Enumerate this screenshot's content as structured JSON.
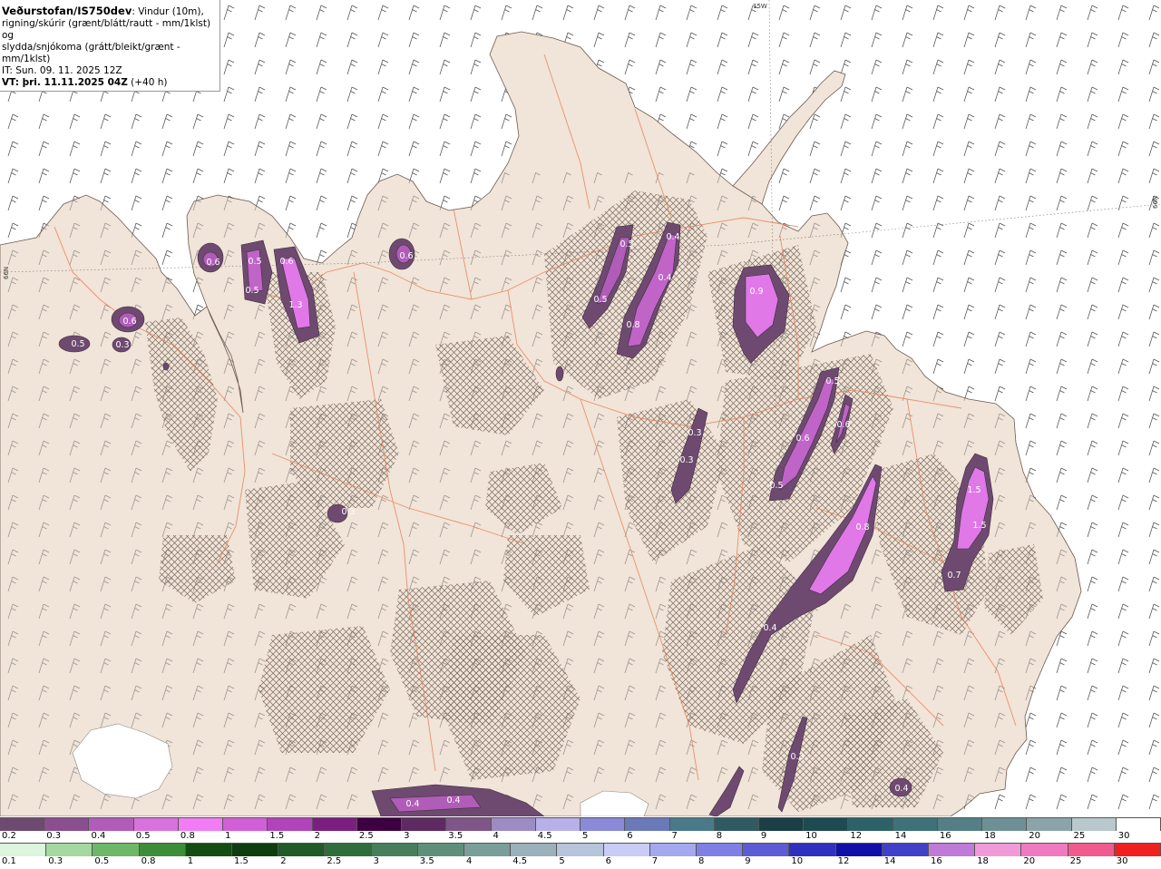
{
  "header": {
    "title": "Veðurstofan/IS750dev",
    "description_line1": ": Vindur (10m),",
    "description_line2": "rigning/skúrir (grænt/blátt/rautt - mm/1klst) og",
    "description_line3": "slydda/snjókoma (grátt/bleikt/grænt - mm/1klst)",
    "init_time": "IT: Sun. 09. 11. 2025 12Z",
    "valid_time": "VT: þri. 11.11.2025 04Z",
    "lead_time": "(+40 h)"
  },
  "grid_labels": {
    "lon": "15W",
    "lat_right": "66N",
    "lat_left": "66N"
  },
  "precip_labels": [
    {
      "text": "0.6",
      "color": "#ffffff"
    },
    {
      "text": "0.5",
      "color": "#ffffff"
    },
    {
      "text": "0.6",
      "color": "#ffffff"
    },
    {
      "text": "0.5",
      "color": "#ffffff"
    },
    {
      "text": "1.3",
      "color": "#ffffff"
    },
    {
      "text": "0.6",
      "color": "#ffffff"
    },
    {
      "text": "0.6",
      "color": "#ffffff"
    },
    {
      "text": "0.5",
      "color": "#ffffff"
    },
    {
      "text": "0.3",
      "color": "#ffffff"
    },
    {
      "text": "0.5",
      "color": "#ffffff"
    },
    {
      "text": "0.4",
      "color": "#ffffff"
    },
    {
      "text": "0.4",
      "color": "#ffffff"
    },
    {
      "text": "0.5",
      "color": "#ffffff"
    },
    {
      "text": "0.8",
      "color": "#ffffff"
    },
    {
      "text": "0.9",
      "color": "#ffffff"
    },
    {
      "text": "0.5",
      "color": "#ffffff"
    },
    {
      "text": "0.6",
      "color": "#ffffff"
    },
    {
      "text": "0.6",
      "color": "#ffffff"
    },
    {
      "text": "0.3",
      "color": "#ffffff"
    },
    {
      "text": "0.3",
      "color": "#ffffff"
    },
    {
      "text": "0.5",
      "color": "#ffffff"
    },
    {
      "text": "0.8",
      "color": "#ffffff"
    },
    {
      "text": "1.5",
      "color": "#ffffff"
    },
    {
      "text": "1.5",
      "color": "#ffffff"
    },
    {
      "text": "0.7",
      "color": "#ffffff"
    },
    {
      "text": "0.4",
      "color": "#ffffff"
    },
    {
      "text": "0.3",
      "color": "#ffffff"
    },
    {
      "text": "0.3",
      "color": "#ffffff"
    },
    {
      "text": "0.4",
      "color": "#ffffff"
    },
    {
      "text": "0.4",
      "color": "#ffffff"
    },
    {
      "text": "0.4",
      "color": "#ffffff"
    }
  ],
  "legend_snow": {
    "labels": [
      "0.2",
      "0.3",
      "0.4",
      "0.5",
      "0.8",
      "1",
      "1.5",
      "2",
      "2.5",
      "3",
      "3.5",
      "4",
      "4.5",
      "5",
      "6",
      "7",
      "8",
      "9",
      "10",
      "12",
      "14",
      "16",
      "18",
      "20",
      "25",
      "30"
    ],
    "colors": [
      "#6e4a70",
      "#8a4f8e",
      "#b05cb8",
      "#d872dc",
      "#f07df4",
      "#d15fd6",
      "#b044b8",
      "#7a1f80",
      "#3d0040",
      "#5e2a62",
      "#7e5688",
      "#9c8cc4",
      "#b8b0e8",
      "#8a8ad8",
      "#6a7ab8",
      "#4a7a8a",
      "#2f5a62",
      "#1a3f47",
      "#1e4a52",
      "#2d6168",
      "#3f7178",
      "#557f86",
      "#6d9096",
      "#8aa4aa",
      "#b8c8cc",
      "#ffffff"
    ]
  },
  "legend_rain": {
    "labels": [
      "0.1",
      "0.3",
      "0.5",
      "0.8",
      "1",
      "1.5",
      "2",
      "2.5",
      "3",
      "3.5",
      "4",
      "4.5",
      "5",
      "6",
      "7",
      "8",
      "9",
      "10",
      "12",
      "14",
      "16",
      "18",
      "20",
      "25",
      "30"
    ],
    "colors": [
      "#dcf5dc",
      "#a4d8a0",
      "#6cb868",
      "#3d8c3a",
      "#134d12",
      "#0e3d10",
      "#1f5a28",
      "#2f6d3d",
      "#467f5a",
      "#5f8f7a",
      "#7a9e99",
      "#9ab0bb",
      "#b6c4dc",
      "#c8ccf6",
      "#a4a8ee",
      "#8080e4",
      "#5c5cd4",
      "#3030c0",
      "#1010a8",
      "#4040c8",
      "#c07ad8",
      "#f09ad8",
      "#f07ac0",
      "#f05a8c",
      "#f02020"
    ]
  }
}
